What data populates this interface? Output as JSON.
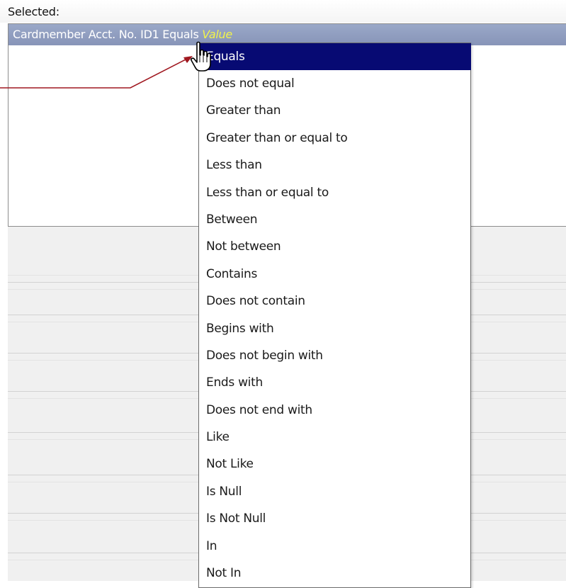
{
  "selected_panel": {
    "label": "Selected:",
    "condition": {
      "field": "Cardmember Acct. No. ID1",
      "operator": "Equals",
      "value_placeholder": "Value"
    }
  },
  "operator_dropdown": {
    "selected": "Equals",
    "options": [
      "Equals",
      "Does not equal",
      "Greater than",
      "Greater than or equal to",
      "Less than",
      "Less than or equal to",
      "Between",
      "Not between",
      "Contains",
      "Does not contain",
      "Begins with",
      "Does not begin with",
      "Ends with",
      "Does not end with",
      "Like",
      "Not Like",
      "Is Null",
      "Is Not Null",
      "In",
      "Not In"
    ]
  },
  "colors": {
    "condition_row_bg": "#8d9abd",
    "value_placeholder": "#f1f34b",
    "dropdown_highlight": "#070a73",
    "annotation_arrow": "#a01820"
  },
  "icons": {
    "cursor": "hand-pointer-icon"
  }
}
